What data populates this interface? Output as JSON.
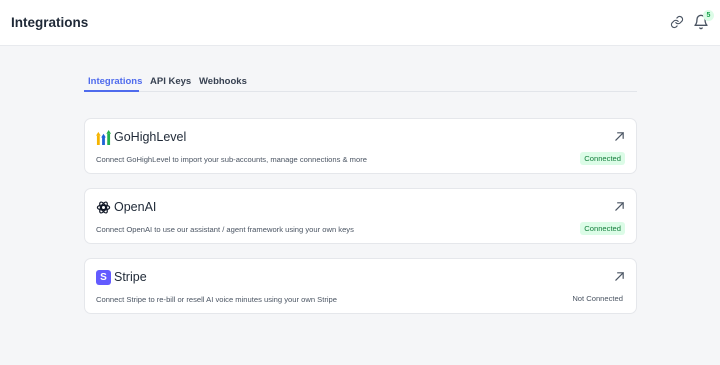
{
  "header": {
    "title": "Integrations",
    "notification_count": "5"
  },
  "tabs": [
    {
      "label": "Integrations",
      "active": true
    },
    {
      "label": "API Keys",
      "active": false
    },
    {
      "label": "Webhooks",
      "active": false
    }
  ],
  "integrations": [
    {
      "name": "GoHighLevel",
      "description": "Connect GoHighLevel to import your sub-accounts, manage connections & more",
      "status": "Connected",
      "icon": "gohighlevel-logo-icon"
    },
    {
      "name": "OpenAI",
      "description": "Connect OpenAI to use our assistant / agent framework using your own keys",
      "status": "Connected",
      "icon": "openai-logo-icon"
    },
    {
      "name": "Stripe",
      "description": "Connect Stripe to re-bill or resell AI voice minutes using your own Stripe",
      "status": "Not Connected",
      "icon": "stripe-logo-icon",
      "logo_letter": "S"
    }
  ],
  "colors": {
    "accent": "#4f6bed",
    "connected_bg": "#dcfce7",
    "connected_text": "#15803d",
    "stripe": "#635bff"
  }
}
